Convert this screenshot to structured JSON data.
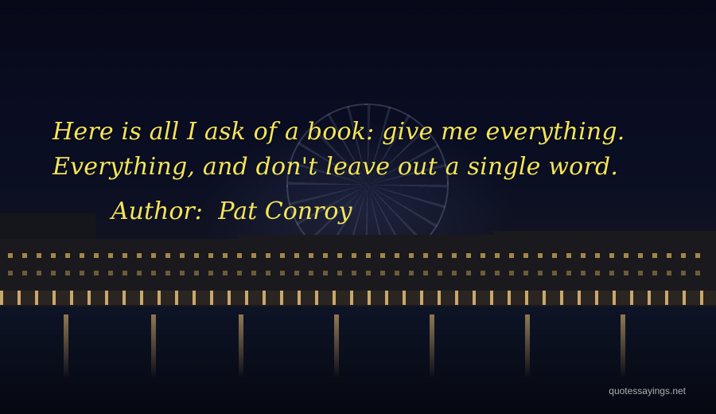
{
  "quote": {
    "line1": "Here is all I ask of a book: give me everything.",
    "line2": "Everything, and don't leave out a single word."
  },
  "author": {
    "label": "Author:",
    "name": "Pat Conroy"
  },
  "watermark": "quotessayings.net",
  "colors": {
    "quote_text": "#f4e45a",
    "sky": "#0a0d22",
    "lights": "#ffd282"
  }
}
